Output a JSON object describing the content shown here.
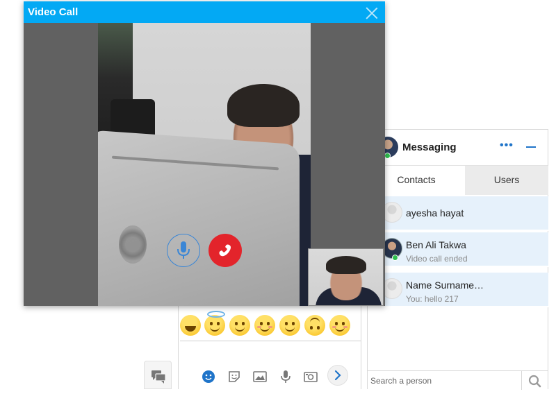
{
  "video_call": {
    "title": "Video Call"
  },
  "messaging": {
    "title": "Messaging",
    "more_label": "•••",
    "tabs": [
      {
        "label": "Contacts",
        "active": true
      },
      {
        "label": "Users",
        "active": false
      }
    ],
    "contacts": [
      {
        "name": "ayesha hayat",
        "subtitle": "",
        "online": false
      },
      {
        "name": "Ben Ali Takwa",
        "subtitle": "Video call ended",
        "online": true
      },
      {
        "name": "Name Surname…",
        "subtitle": "You: hello 217",
        "online": false
      }
    ],
    "search": {
      "placeholder": "Search a person",
      "value": ""
    }
  },
  "colors": {
    "accent": "#03a9f4",
    "link_blue": "#1f74c9",
    "hangup_red": "#e3242b",
    "online_green": "#2fbf4f",
    "contact_bg": "#e6f1fb"
  },
  "icons": {
    "mic": "microphone-icon",
    "hangup": "phone-hangup-icon",
    "close": "close-icon",
    "minimize": "minimize-icon",
    "search": "search-icon",
    "emoji": "smiley-icon",
    "sticker": "sticker-icon",
    "image": "image-icon",
    "voice": "microphone-icon",
    "camera": "camera-icon",
    "send": "send-icon",
    "chat": "chat-bubbles-icon"
  }
}
